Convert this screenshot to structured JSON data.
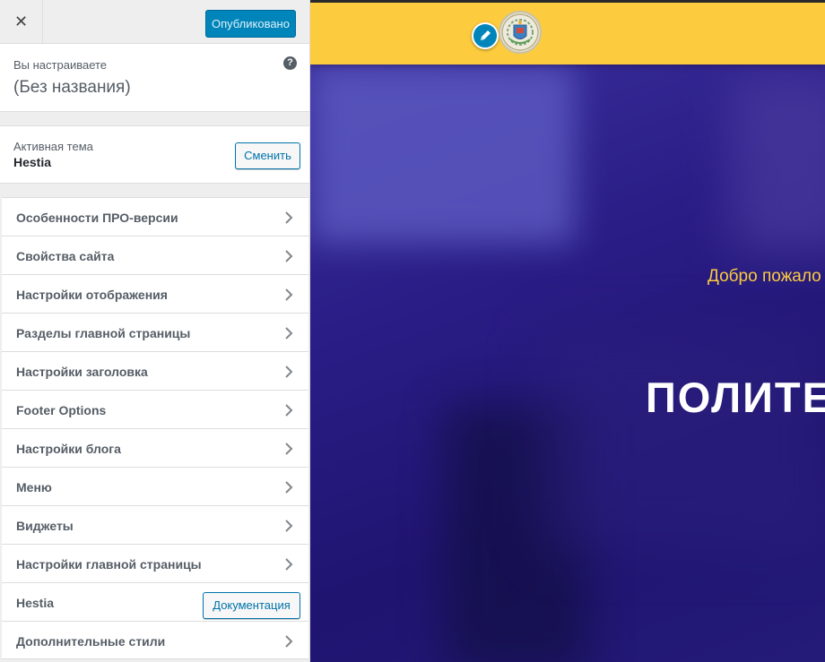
{
  "sidebar": {
    "close_symbol": "✕",
    "publish_label": "Опубликовано",
    "info": {
      "label": "Вы настраиваете",
      "title": "(Без названия)",
      "help_symbol": "?"
    },
    "theme": {
      "label": "Активная тема",
      "name": "Hestia",
      "change_label": "Сменить"
    },
    "menu": [
      {
        "label": "Особенности ПРО-версии"
      },
      {
        "label": "Свойства сайта"
      },
      {
        "label": "Настройки отображения"
      },
      {
        "label": "Разделы главной страницы"
      },
      {
        "label": "Настройки заголовка"
      },
      {
        "label": "Footer Options"
      },
      {
        "label": "Настройки блога"
      },
      {
        "label": "Меню"
      },
      {
        "label": "Виджеты"
      },
      {
        "label": "Настройки главной страницы"
      },
      {
        "label": "Hestia",
        "button_label": "Документация"
      },
      {
        "label": "Дополнительные стили"
      }
    ]
  },
  "preview": {
    "welcome_text": "Добро пожало",
    "hero_title": "ПОЛИТЕ"
  },
  "colors": {
    "accent": "#0085ba",
    "header_bg": "#fdcb3e",
    "hero_bg": "#2a1d86"
  },
  "icons": [
    "close-icon",
    "help-icon",
    "chevron-right-icon",
    "pencil-icon",
    "site-logo"
  ]
}
